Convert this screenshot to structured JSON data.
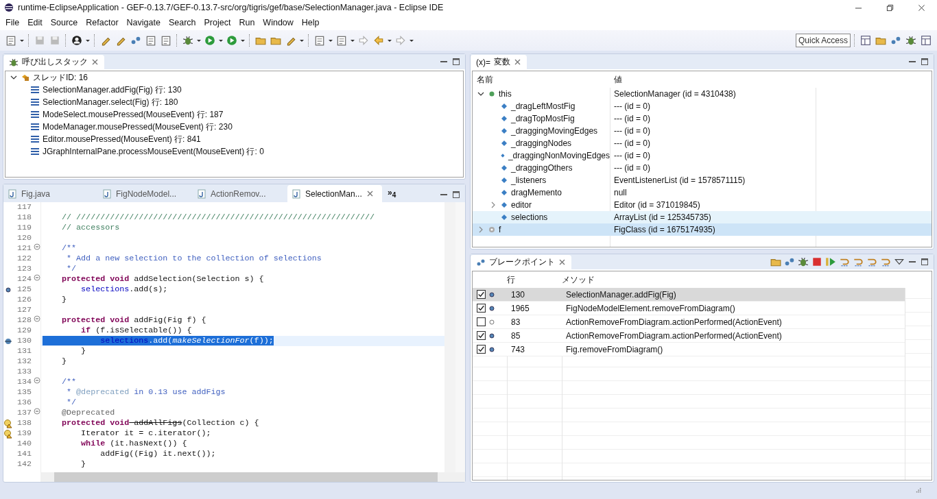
{
  "window": {
    "title": "runtime-EclipseApplication - GEF-0.13.7/GEF-0.13.7-src/org/tigris/gef/base/SelectionManager.java - Eclipse IDE"
  },
  "menu": [
    "File",
    "Edit",
    "Source",
    "Refactor",
    "Navigate",
    "Search",
    "Project",
    "Run",
    "Window",
    "Help"
  ],
  "quick_access": {
    "placeholder": "Quick Access"
  },
  "call_stack": {
    "title": "呼び出しスタック",
    "thread": {
      "label": "スレッドID: 16",
      "expanded": true,
      "children": [
        {
          "label": "SelectionManager.addFig(Fig) 行: 130"
        },
        {
          "label": "SelectionManager.select(Fig) 行: 180"
        },
        {
          "label": "ModeSelect.mousePressed(MouseEvent) 行: 187"
        },
        {
          "label": "ModeManager.mousePressed(MouseEvent) 行: 230"
        },
        {
          "label": "Editor.mousePressed(MouseEvent) 行: 841"
        },
        {
          "label": "JGraphInternalPane.processMouseEvent(MouseEvent) 行: 0"
        }
      ]
    }
  },
  "editor": {
    "tabs": [
      {
        "label": "Fig.java",
        "selected": false
      },
      {
        "label": "FigNodeModel...",
        "selected": false
      },
      {
        "label": "ActionRemov...",
        "selected": false
      },
      {
        "label": "SelectionMan...",
        "selected": true
      }
    ],
    "overflow": "»$_{4}$",
    "lines": [
      {
        "number": "117"
      },
      {
        "number": "118",
        "segments": [
          {
            "text": "    // //////////////////////////////////////////////////////////////",
            "kind": "comment"
          }
        ]
      },
      {
        "number": "119",
        "segments": [
          {
            "text": "    // accessors",
            "kind": "comment"
          }
        ]
      },
      {
        "number": "120"
      },
      {
        "number": "121",
        "fold": true,
        "segments": [
          {
            "text": "    /**",
            "kind": "javadoc"
          }
        ]
      },
      {
        "number": "122",
        "segments": [
          {
            "text": "     * Add a new selection to the collection of selections",
            "kind": "javadoc"
          }
        ]
      },
      {
        "number": "123",
        "segments": [
          {
            "text": "     */",
            "kind": "javadoc"
          }
        ]
      },
      {
        "number": "124",
        "fold": true,
        "segments": [
          {
            "text": "    protected void",
            "kind": "keyword"
          },
          {
            "text": " addSelection(Selection s) {",
            "kind": "plain"
          }
        ]
      },
      {
        "number": "125",
        "breakpoint": true,
        "segments": [
          {
            "text": "        selections",
            "kind": "field"
          },
          {
            "text": ".add(s);",
            "kind": "plain"
          }
        ]
      },
      {
        "number": "126",
        "segments": [
          {
            "text": "    }",
            "kind": "plain"
          }
        ]
      },
      {
        "number": "127"
      },
      {
        "number": "128",
        "fold": true,
        "segments": [
          {
            "text": "    protected void",
            "kind": "keyword"
          },
          {
            "text": " addFig(Fig f) {",
            "kind": "plain"
          }
        ]
      },
      {
        "number": "129",
        "segments": [
          {
            "text": "        if",
            "kind": "keyword"
          },
          {
            "text": " (f.isSelectable()) {",
            "kind": "plain"
          }
        ]
      },
      {
        "number": "130",
        "current": true,
        "segments": [
          {
            "text": "            selections",
            "kind": "field"
          },
          {
            "text": ".add(",
            "kind": "plain"
          },
          {
            "text": "makeSelectionFor",
            "kind": "italic"
          },
          {
            "text": "(f));",
            "kind": "plain"
          }
        ]
      },
      {
        "number": "131",
        "segments": [
          {
            "text": "        }",
            "kind": "plain"
          }
        ]
      },
      {
        "number": "132",
        "segments": [
          {
            "text": "    }",
            "kind": "plain"
          }
        ]
      },
      {
        "number": "133"
      },
      {
        "number": "134",
        "fold": true,
        "segments": [
          {
            "text": "    /**",
            "kind": "javadoc"
          }
        ]
      },
      {
        "number": "135",
        "segments": [
          {
            "text": "     *",
            "kind": "javadoc"
          },
          {
            "text": " @deprecated",
            "kind": "doctag"
          },
          {
            "text": " in 0.13 use addFigs",
            "kind": "javadoc"
          }
        ]
      },
      {
        "number": "136",
        "segments": [
          {
            "text": "     */",
            "kind": "javadoc"
          }
        ]
      },
      {
        "number": "137",
        "fold": true,
        "segments": [
          {
            "text": "    @Deprecated",
            "kind": "annotation"
          }
        ]
      },
      {
        "number": "138",
        "warning": true,
        "segments": [
          {
            "text": "    protected void",
            "kind": "keyword"
          },
          {
            "text": " addAllFigs",
            "kind": "deprecated"
          },
          {
            "text": "(Collection c) {",
            "kind": "plain"
          }
        ]
      },
      {
        "number": "139",
        "warning": true,
        "segments": [
          {
            "text": "        Iterator it = c.iterator();",
            "kind": "plain"
          }
        ]
      },
      {
        "number": "140",
        "segments": [
          {
            "text": "        while",
            "kind": "keyword"
          },
          {
            "text": " (it.hasNext()) {",
            "kind": "plain"
          }
        ]
      },
      {
        "number": "141",
        "segments": [
          {
            "text": "            addFig((Fig) it.next());",
            "kind": "plain"
          }
        ]
      },
      {
        "number": "142",
        "segments": [
          {
            "text": "        }",
            "kind": "plain"
          }
        ]
      }
    ]
  },
  "variables": {
    "title": "変数",
    "title_prefix": "(x)=",
    "columns": [
      "名前",
      "値"
    ],
    "rows": [
      {
        "name": "this",
        "value": "SelectionManager (id = 4310438)",
        "kind": "local",
        "expanded": true,
        "selected": false,
        "children": [
          {
            "name": "_dragLeftMostFig",
            "value": "--- (id = 0)",
            "kind": "field",
            "selected": false
          },
          {
            "name": "_dragTopMostFig",
            "value": "--- (id = 0)",
            "kind": "field",
            "selected": false
          },
          {
            "name": "_draggingMovingEdges",
            "value": "--- (id = 0)",
            "kind": "field",
            "selected": false
          },
          {
            "name": "_draggingNodes",
            "value": "--- (id = 0)",
            "kind": "field",
            "selected": false
          },
          {
            "name": "_draggingNonMovingEdges",
            "value": "--- (id = 0)",
            "kind": "field",
            "selected": false
          },
          {
            "name": "_draggingOthers",
            "value": "--- (id = 0)",
            "kind": "field",
            "selected": false
          },
          {
            "name": "_listeners",
            "value": "EventListenerList (id = 1578571115)",
            "kind": "field",
            "selected": false
          },
          {
            "name": "dragMemento",
            "value": "null",
            "kind": "field",
            "selected": false
          },
          {
            "name": "editor",
            "value": "Editor (id = 371019845)",
            "kind": "field",
            "expanded": false,
            "selected": false
          },
          {
            "name": "selections",
            "value": "ArrayList (id = 125345735)",
            "kind": "field",
            "hover": true,
            "selected": false
          }
        ]
      },
      {
        "name": "f",
        "value": "FigClass (id = 1675174935)",
        "kind": "parameter",
        "expanded": false,
        "selected": true
      }
    ]
  },
  "breakpoints": {
    "title": "ブレークポイント",
    "columns": [
      "行",
      "メソッド"
    ],
    "rows": [
      {
        "checked": true,
        "line": "130",
        "method": "SelectionManager.addFig(Fig)",
        "selected": true
      },
      {
        "checked": true,
        "line": "1965",
        "method": "FigNodeModelElement.removeFromDiagram()",
        "selected": false
      },
      {
        "checked": false,
        "line": "83",
        "method": "ActionRemoveFromDiagram.actionPerformed(ActionEvent)",
        "selected": false
      },
      {
        "checked": true,
        "line": "85",
        "method": "ActionRemoveFromDiagram.actionPerformed(ActionEvent)",
        "selected": false
      },
      {
        "checked": true,
        "line": "743",
        "method": "Fig.removeFromDiagram()",
        "selected": false
      }
    ]
  }
}
